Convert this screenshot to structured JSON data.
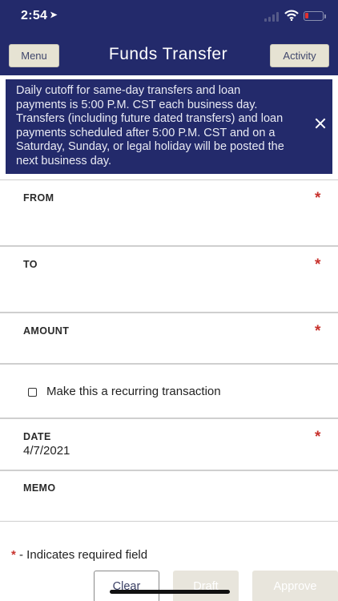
{
  "status_bar": {
    "time": "2:54"
  },
  "header": {
    "title": "Funds Transfer",
    "menu_label": "Menu",
    "activity_label": "Activity"
  },
  "banner": {
    "text": "Daily cutoff for same-day transfers and loan payments is 5:00 P.M. CST each business day. Transfers (including future dated transfers) and loan payments scheduled after 5:00 P.M. CST and on a Saturday, Sunday, or legal holiday will be posted the next business day."
  },
  "form": {
    "from_label": "FROM",
    "to_label": "TO",
    "amount_label": "AMOUNT",
    "recurring_label": "Make this a recurring transaction",
    "recurring_checked": false,
    "date_label": "DATE",
    "date_value": "4/7/2021",
    "memo_label": "MEMO",
    "required_mark": "*"
  },
  "footer": {
    "required_note": "- Indicates required field",
    "clear_label": "Clear",
    "draft_label": "Draft",
    "approve_label": "Approve"
  },
  "colors": {
    "header": "#232a6b",
    "required": "#c8322d",
    "button_bg": "#e6e3d3"
  }
}
